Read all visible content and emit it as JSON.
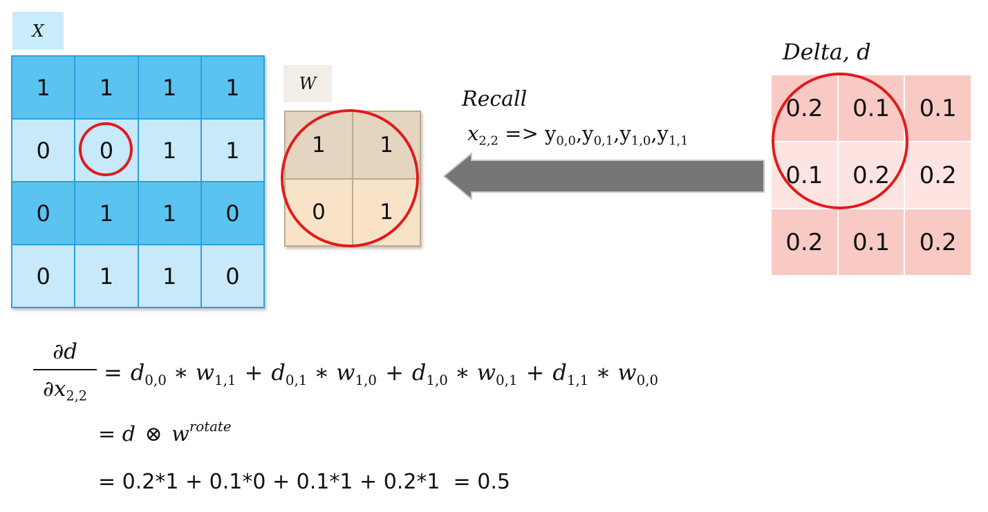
{
  "x_matrix": {
    "label": "X",
    "rows": [
      [
        "1",
        "1",
        "1",
        "1"
      ],
      [
        "0",
        "0",
        "1",
        "1"
      ],
      [
        "0",
        "1",
        "1",
        "0"
      ],
      [
        "0",
        "1",
        "1",
        "0"
      ]
    ]
  },
  "w_matrix": {
    "label": "W",
    "rows": [
      [
        "1",
        "1"
      ],
      [
        "0",
        "1"
      ]
    ]
  },
  "delta_matrix": {
    "label": "Delta, d",
    "rows": [
      [
        "0.2",
        "0.1",
        "0.1"
      ],
      [
        "0.1",
        "0.2",
        "0.2"
      ],
      [
        "0.2",
        "0.1",
        "0.2"
      ]
    ]
  },
  "recall": {
    "title": "Recall",
    "x": "x",
    "x_sub": "2,2",
    "arrow_text": " => ",
    "terms": [
      {
        "base": "y",
        "sub": "0,0"
      },
      {
        "base": "y",
        "sub": "0,1"
      },
      {
        "base": "y",
        "sub": "1,0"
      },
      {
        "base": "y",
        "sub": "1,1"
      }
    ],
    "sep": ","
  },
  "equation": {
    "numerator": "∂d",
    "denominator": "∂x",
    "denominator_sub": "2,2",
    "line1": [
      {
        "d": "d",
        "dsub": "0,0",
        "w": "w",
        "wsub": "1,1"
      },
      {
        "d": "d",
        "dsub": "0,1",
        "w": "w",
        "wsub": "1,0"
      },
      {
        "d": "d",
        "dsub": "1,0",
        "w": "w",
        "wsub": "0,1"
      },
      {
        "d": "d",
        "dsub": "1,1",
        "w": "w",
        "wsub": "0,0"
      }
    ],
    "eq": "=",
    "times": "∗",
    "plus": "+",
    "line2_eq": "=",
    "line2_d": "d",
    "line2_op": "⊗",
    "line2_w": "w",
    "line2_sup": "rotate",
    "line3": "= 0.2*1 + 0.1*0 + 0.1*1 + 0.2*1  = 0.5"
  },
  "colors": {
    "x_dark": "#5bc3f0",
    "x_light": "#c7e9f9",
    "x_label_bg": "#c9ecfb",
    "w_top": "#e4d5c1",
    "w_bottom": "#f9e3c8",
    "w_label_bg": "#f2ede6",
    "d_dark": "#f9cac4",
    "d_light": "#fde4e1",
    "ring": "#e01b1b",
    "arrow": "#767676"
  }
}
